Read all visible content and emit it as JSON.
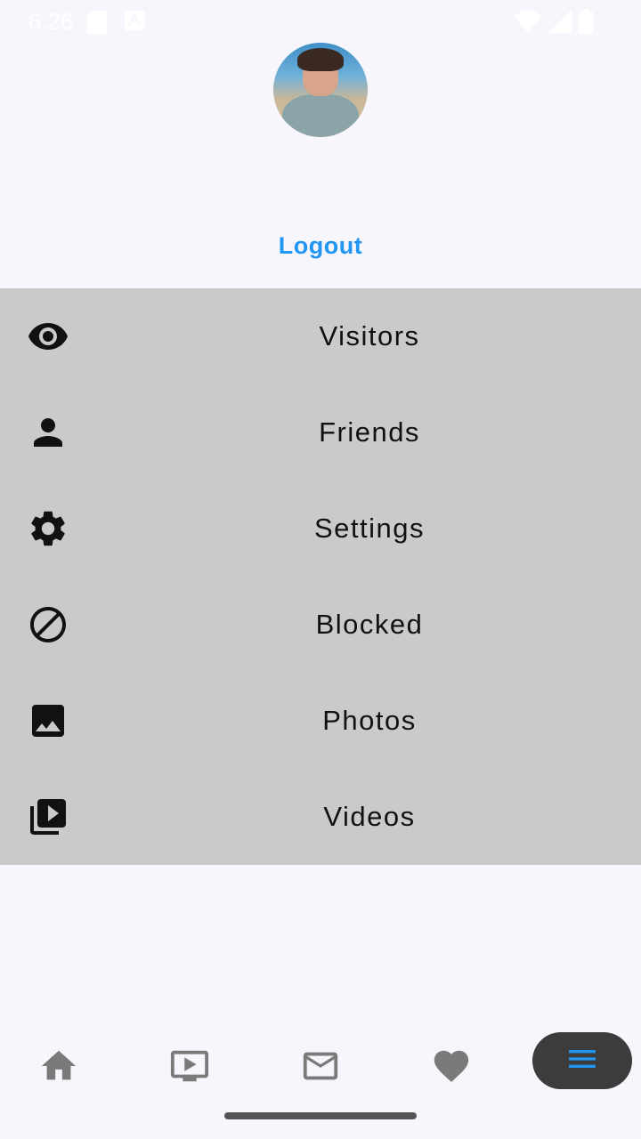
{
  "status_bar": {
    "time": "6:26",
    "left_icons": [
      "sd-card-icon",
      "text-notification-icon"
    ],
    "right_icons": [
      "wifi-icon",
      "signal-icon",
      "battery-icon"
    ]
  },
  "profile": {
    "logout_label": "Logout"
  },
  "menu": {
    "items": [
      {
        "label": "Visitors",
        "icon": "eye-icon"
      },
      {
        "label": "Friends",
        "icon": "person-icon"
      },
      {
        "label": "Settings",
        "icon": "gear-icon"
      },
      {
        "label": "Blocked",
        "icon": "blocked-icon"
      },
      {
        "label": "Photos",
        "icon": "image-icon"
      },
      {
        "label": "Videos",
        "icon": "video-library-icon"
      }
    ]
  },
  "bottom_nav": {
    "items": [
      {
        "icon": "home-icon"
      },
      {
        "icon": "tv-play-icon"
      },
      {
        "icon": "mail-icon"
      },
      {
        "icon": "heart-icon"
      },
      {
        "icon": "menu-icon",
        "active": true
      }
    ]
  },
  "colors": {
    "accent": "#2196f3",
    "menu_background": "#cacaca",
    "page_background": "#f7f6fd",
    "active_nav_background": "#3c3c3c",
    "inactive_nav_icon": "#7a7a7a"
  }
}
